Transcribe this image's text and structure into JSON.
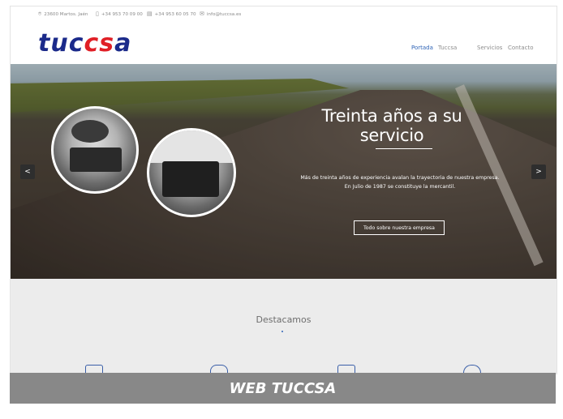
{
  "topbar": {
    "address": "23600 Martos. Jaén",
    "phone": "+34 953 70 09 00",
    "fax": "+34 953 60 05 70",
    "email": "info@tuccsa.es",
    "icons": [
      "location-pin-icon",
      "phone-icon",
      "fax-icon",
      "mail-icon"
    ]
  },
  "header": {
    "logo_main": "tuc",
    "logo_accent": "cs",
    "logo_end": "a",
    "menu": [
      {
        "label": "Portada",
        "active": true
      },
      {
        "label": "Tuccsa",
        "active": false
      },
      {
        "label": "Servicios",
        "active": false
      },
      {
        "label": "Contacto",
        "active": false
      }
    ]
  },
  "hero": {
    "title": "Treinta años a su servicio",
    "text_line1": "Más de treinta años de experiencia avalan la trayectoria de nuestra empresa.",
    "text_line2": "En Julio de 1987 se constituye la mercantil.",
    "button_label": "Todo sobre nuestra empresa",
    "prev_label": "<",
    "next_label": ">"
  },
  "section": {
    "title": "Destacamos"
  },
  "caption": "WEB TUCCSA",
  "colors": {
    "brand_blue": "#1b2a8a",
    "brand_red": "#e01f26",
    "active_menu": "#2f64b7",
    "caption_bg": "#888888"
  }
}
